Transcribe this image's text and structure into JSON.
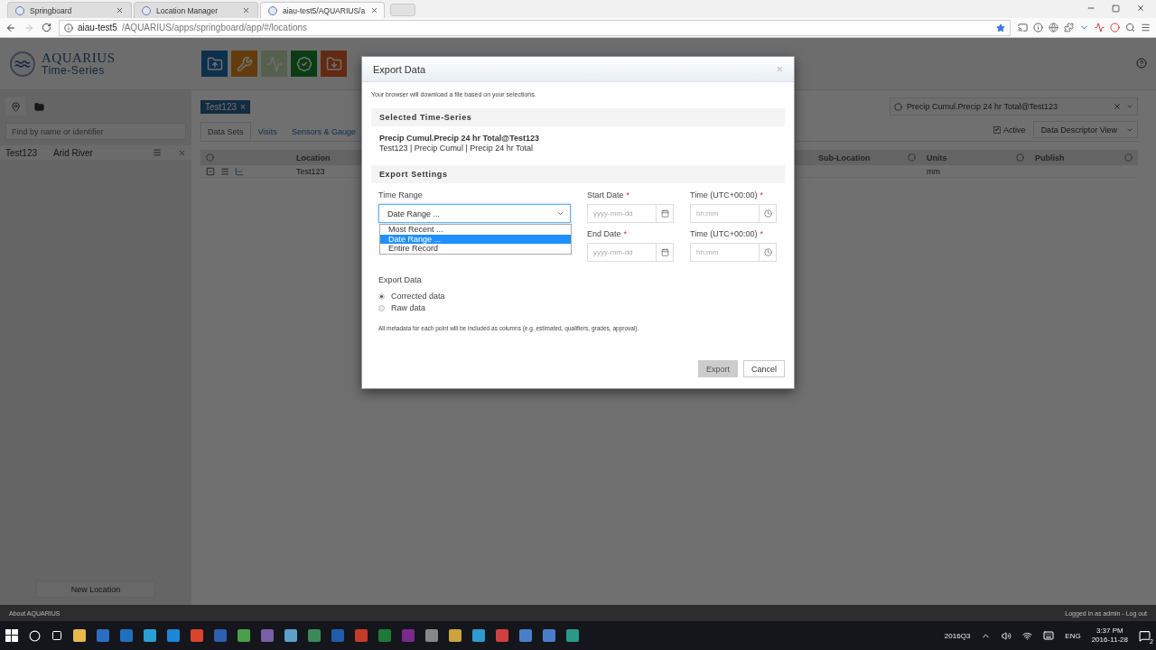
{
  "browser": {
    "tabs": [
      {
        "label": "Springboard",
        "selected": false
      },
      {
        "label": "Location Manager",
        "selected": false
      },
      {
        "label": "aiau-test5/AQUARIUS/a",
        "selected": true
      }
    ],
    "url_host": "aiau-test5",
    "url_path": "/AQUARIUS/apps/springboard/app/#/locations"
  },
  "app": {
    "logo_title": "AQUARIUS",
    "logo_subtitle": "Time-Series",
    "search_placeholder": "Find by name or identifier",
    "locations": [
      {
        "id": "Test123",
        "name": "Arid River"
      }
    ],
    "new_location": "New Location",
    "chip": {
      "label": "Test123",
      "close": "×"
    },
    "tabs": [
      {
        "label": "Data Sets",
        "selected": true
      },
      {
        "label": "Visits",
        "selected": false
      },
      {
        "label": "Sensors & Gauge",
        "selected": false
      }
    ],
    "series_picker": "Precip Cumul.Precip 24 hr Total@Test123",
    "active": {
      "label": "Active",
      "checked": true
    },
    "view_select": "Data Descriptor View",
    "columns_left": [
      "Location"
    ],
    "columns_right": [
      "Sub-Location",
      "Units",
      "Publish"
    ],
    "rows": [
      {
        "location": "Test123",
        "units": "mm"
      }
    ]
  },
  "dialog": {
    "title": "Export Data",
    "close": "×",
    "intro": "Your browser will download a file based on your selections.",
    "selected_heading": "Selected Time-Series",
    "series_name": "Precip Cumul.Precip 24 hr Total@Test123",
    "series_path": "Test123 | Precip Cumul | Precip 24 hr Total",
    "settings_heading": "Export Settings",
    "time_range_label": "Time Range",
    "time_range_value": "Date Range ...",
    "time_range_options": [
      {
        "label": "Most Recent ...",
        "selected": false
      },
      {
        "label": "Date Range ...",
        "selected": true
      },
      {
        "label": "Entire Record",
        "selected": false
      }
    ],
    "date_rows": [
      {
        "date_label": "Start Date",
        "time_label": "Time (UTC+00:00)",
        "date_placeholder": "yyyy-mm-dd",
        "time_placeholder": "hh:mm",
        "required": "*"
      },
      {
        "date_label": "End Date",
        "time_label": "Time (UTC+00:00)",
        "date_placeholder": "yyyy-mm-dd",
        "time_placeholder": "hh:mm",
        "required": "*"
      }
    ],
    "export_data_label": "Export Data",
    "radios": [
      {
        "label": "Corrected data",
        "selected": true
      },
      {
        "label": "Raw data",
        "selected": false
      }
    ],
    "note": "All metadata for each point will be included as columns (e.g. estimated, qualifiers, grades, approval).",
    "buttons": [
      {
        "label": "Export",
        "kind": "primary",
        "disabled": true
      },
      {
        "label": "Cancel",
        "kind": "default",
        "disabled": false
      }
    ]
  },
  "footer": {
    "left": "About AQUARIUS",
    "right": "Logged in as admin - Log out"
  },
  "taskbar": {
    "toolbar_label": "2016Q3",
    "language": "ENG",
    "time": "3:37 PM",
    "date": "2016-11-28",
    "notifications": "2"
  }
}
